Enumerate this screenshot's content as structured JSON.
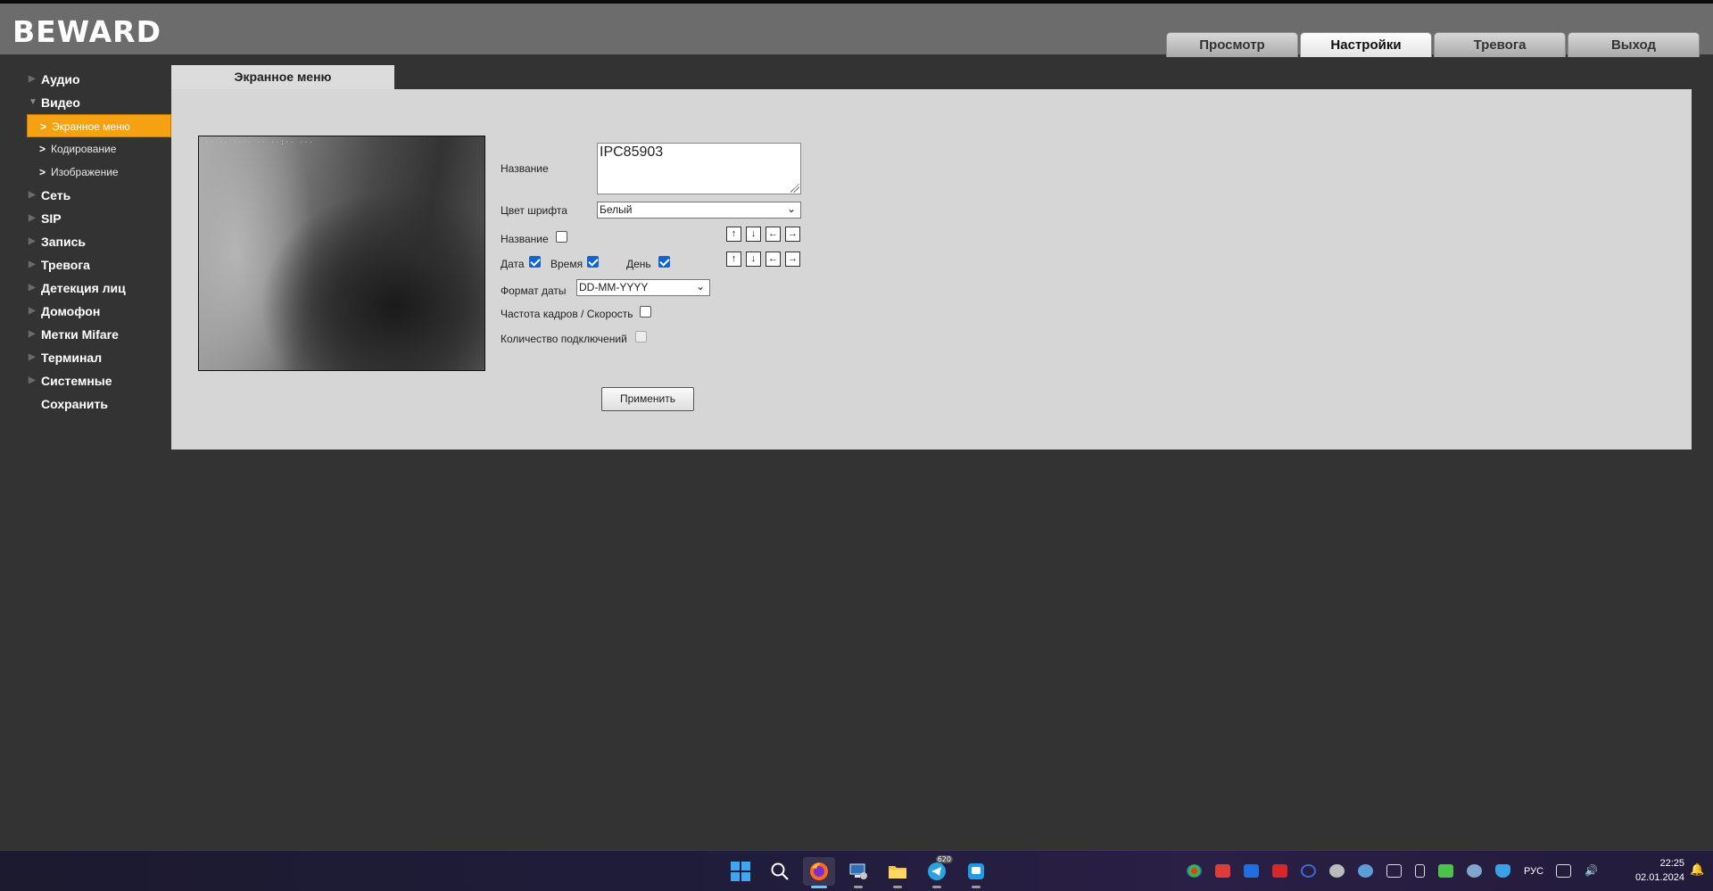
{
  "brand": "BEWARD",
  "top_nav": [
    {
      "label": "Просмотр",
      "active": false
    },
    {
      "label": "Настройки",
      "active": true
    },
    {
      "label": "Тревога",
      "active": false
    },
    {
      "label": "Выход",
      "active": false
    }
  ],
  "sidebar": {
    "audio": "Аудио",
    "video": "Видео",
    "video_sub": [
      "Экранное меню",
      "Кодирование",
      "Изображение"
    ],
    "network": "Сеть",
    "sip": "SIP",
    "record": "Запись",
    "alarm": "Тревога",
    "face_detect": "Детекция лиц",
    "intercom": "Домофон",
    "mifare": "Метки Mifare",
    "terminal": "Терминал",
    "system": "Системные",
    "save": "Сохранить",
    "accent_color": "#f5a111"
  },
  "section_tab": "Экранное меню",
  "form": {
    "name_label": "Название",
    "name_value": "IPC85903",
    "font_color_label": "Цвет шрифта",
    "font_color_value": "Белый",
    "show_name_label": "Название",
    "show_name_checked": false,
    "date_label": "Дата",
    "date_checked": true,
    "time_label": "Время",
    "time_checked": true,
    "day_label": "День",
    "day_checked": true,
    "date_format_label": "Формат даты",
    "date_format_value": "DD-MM-YYYY",
    "fps_label": "Частота кадров / Скорость",
    "fps_checked": false,
    "connections_label": "Количество подключений",
    "connections_checked": false,
    "apply_label": "Применить",
    "arrow_icons": [
      "↑",
      "↓",
      "←",
      "→"
    ]
  },
  "taskbar": {
    "telegram_badge": "620",
    "lang": "РУС",
    "time": "22:25",
    "date": "02.01.2024"
  }
}
